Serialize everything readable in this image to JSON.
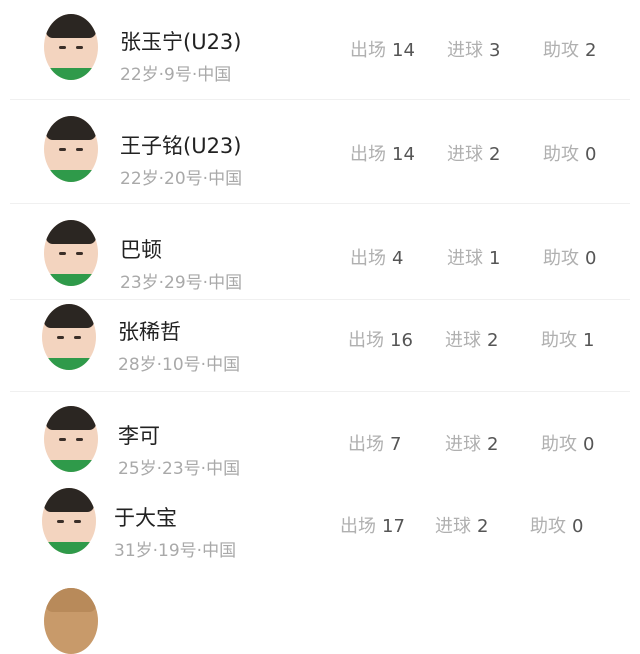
{
  "labels": {
    "apps": "出场",
    "goals": "进球",
    "assists": "助攻"
  },
  "players": [
    {
      "name": "张玉宁(U23)",
      "info": "22岁·9号·中国",
      "apps": "14",
      "goals": "3",
      "assists": "2"
    },
    {
      "name": "王子铭(U23)",
      "info": "22岁·20号·中国",
      "apps": "14",
      "goals": "2",
      "assists": "0"
    },
    {
      "name": "巴顿",
      "info": "23岁·29号·中国",
      "apps": "4",
      "goals": "1",
      "assists": "0"
    },
    {
      "name": "张稀哲",
      "info": "28岁·10号·中国",
      "apps": "16",
      "goals": "2",
      "assists": "1"
    },
    {
      "name": "李可",
      "info": "25岁·23号·中国",
      "apps": "7",
      "goals": "2",
      "assists": "0"
    },
    {
      "name": "于大宝",
      "info": "31岁·19号·中国",
      "apps": "17",
      "goals": "2",
      "assists": "0"
    }
  ]
}
